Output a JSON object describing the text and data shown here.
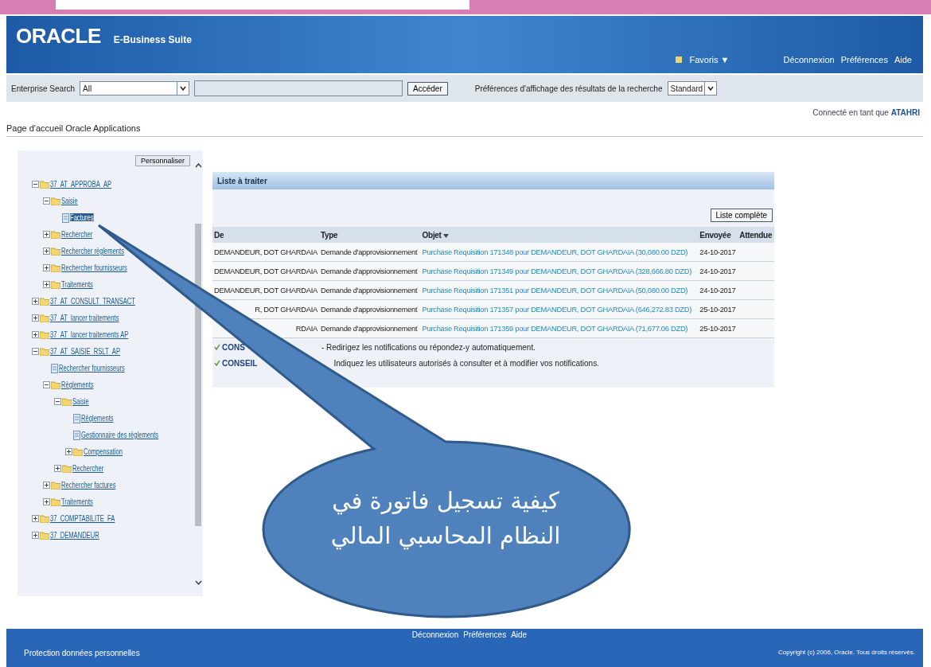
{
  "header": {
    "logo": "ORACLE",
    "product": "E-Business Suite",
    "favorites": "Favoris ▼",
    "links": [
      "Déconnexion",
      "Préférences",
      "Aide"
    ]
  },
  "search": {
    "label": "Enterprise Search",
    "scope": "All",
    "button": "Accéder",
    "prefs_label": "Préférences d'affichage des résultats de la recherche",
    "prefs_value": "Standard"
  },
  "connected": {
    "label": "Connecté en tant que",
    "user": "ATAHRI"
  },
  "page_title": "Page d'accueil Oracle Applications",
  "sidebar": {
    "button": "Personnaliser",
    "tree": [
      {
        "label": "37_AT_APPROBA_AP",
        "kind": "folder",
        "expanded": true,
        "selected": false,
        "children": [
          {
            "label": "Saisie",
            "kind": "folder",
            "expanded": true,
            "selected": false,
            "children": [
              {
                "label": "Factures",
                "kind": "page",
                "selected": true
              }
            ]
          },
          {
            "label": "Rechercher",
            "kind": "folder",
            "expanded": false,
            "selected": false
          },
          {
            "label": "Rechercher règlements",
            "kind": "folder",
            "expanded": false,
            "selected": false
          },
          {
            "label": "Rechercher fournisseurs",
            "kind": "folder",
            "expanded": false,
            "selected": false
          },
          {
            "label": "Traitements",
            "kind": "folder",
            "expanded": false,
            "selected": false
          }
        ]
      },
      {
        "label": "37_AT_CONSULT_TRANSACT",
        "kind": "folder",
        "expanded": false,
        "selected": false
      },
      {
        "label": "37_AT_lancer traitements",
        "kind": "folder",
        "expanded": false,
        "selected": false
      },
      {
        "label": "37_AT_lancer traitements AP",
        "kind": "folder",
        "expanded": false,
        "selected": false
      },
      {
        "label": "37_AT_SAISIE_RSLT_AP",
        "kind": "folder",
        "expanded": true,
        "selected": false,
        "children": [
          {
            "label": "Rechercher fournisseurs",
            "kind": "page",
            "selected": false
          },
          {
            "label": "Règlements",
            "kind": "folder",
            "expanded": true,
            "selected": false,
            "children": [
              {
                "label": "Saisie",
                "kind": "folder",
                "expanded": true,
                "selected": false,
                "children": [
                  {
                    "label": "Règlements",
                    "kind": "page",
                    "selected": false
                  },
                  {
                    "label": "Gestionnaire des règlements",
                    "kind": "page",
                    "selected": false
                  },
                  {
                    "label": "Compensation",
                    "kind": "folder",
                    "expanded": false,
                    "selected": false
                  }
                ]
              },
              {
                "label": "Rechercher",
                "kind": "folder",
                "expanded": false,
                "selected": false
              }
            ]
          },
          {
            "label": "Rechercher factures",
            "kind": "folder",
            "expanded": false,
            "selected": false
          },
          {
            "label": "Traitements",
            "kind": "folder",
            "expanded": false,
            "selected": false
          }
        ]
      },
      {
        "label": "37_COMPTABILITE_FA",
        "kind": "folder",
        "expanded": false,
        "selected": false
      },
      {
        "label": "37_DEMANDEUR",
        "kind": "folder",
        "expanded": false,
        "selected": false
      }
    ]
  },
  "worklist": {
    "title": "Liste à traiter",
    "button": "Liste complète",
    "columns": [
      "De",
      "Type",
      "Objet",
      "Envoyée",
      "Attendue"
    ],
    "rows": [
      {
        "from": "DEMANDEUR, DOT GHARDAIA",
        "type": "Demande d'approvisionnement",
        "subject": "Purchase Requisition 171348 pour DEMANDEUR, DOT GHARDAIA (30,080.00 DZD)",
        "sent": "24-10-2017"
      },
      {
        "from": "DEMANDEUR, DOT GHARDAIA",
        "type": "Demande d'approvisionnement",
        "subject": "Purchase Requisition 171349 pour DEMANDEUR, DOT GHARDAIA (328,666.80 DZD)",
        "sent": "24-10-2017"
      },
      {
        "from": "DEMANDEUR, DOT GHARDAIA",
        "type": "Demande d'approvisionnement",
        "subject": "Purchase Requisition 171351 pour DEMANDEUR, DOT GHARDAIA (50,080.00 DZD)",
        "sent": "24-10-2017"
      },
      {
        "from": "R, DOT GHARDAIA",
        "type": "Demande d'approvisionnement",
        "subject": "Purchase Requisition 171357 pour DEMANDEUR, DOT GHARDAIA (646,272.83 DZD)",
        "sent": "25-10-2017"
      },
      {
        "from": "RDAIA",
        "type": "Demande d'approvisionnement",
        "subject": "Purchase Requisition 171359 pour DEMANDEUR, DOT GHARDAIA (71,677.06 DZD)",
        "sent": "25-10-2017"
      }
    ],
    "tips": [
      {
        "tag": "CONS",
        "text": "- Redirigez les notifications ou répondez-y automatiquement."
      },
      {
        "tag": "CONSEIL",
        "text": "Indiquez les utilisateurs autorisés à consulter et à modifier vos notifications."
      }
    ]
  },
  "footer": {
    "links": [
      "Déconnexion",
      "Préférences",
      "Aide"
    ],
    "privacy": "Protection données personnelles",
    "copyright": "Copyright (c) 2006, Oracle. Tous droits réservés."
  },
  "callout": {
    "lines": [
      "كيفية تسجيل فاتورة في",
      "النظام المحاسبي المالي"
    ]
  }
}
